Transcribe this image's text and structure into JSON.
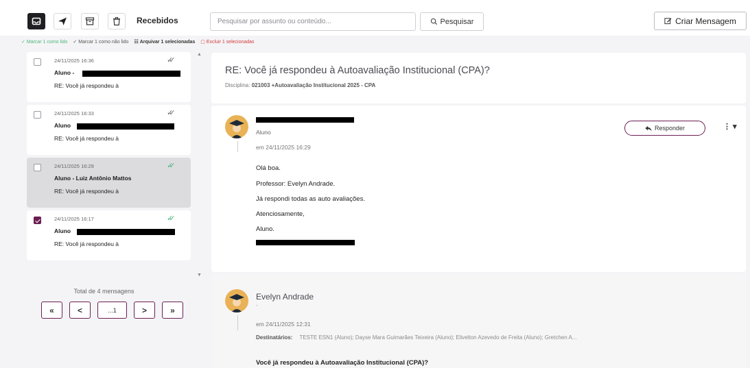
{
  "toolbar": {
    "folder_title": "Recebidos",
    "search_placeholder": "Pesquisar por assunto ou conteúdo...",
    "search_label": "Pesquisar",
    "create_label": "Criar Mensagem"
  },
  "actions": {
    "mark_read": "Marcar 1 como lido",
    "mark_unread": "Marcar 1 como não lido",
    "archive": "Arquivar 1 selecionadas",
    "delete": "Excluir 1 selecionadas"
  },
  "messages": [
    {
      "date": "24/11/2025 16:36",
      "sender": "Aluno -",
      "subject": "RE: Você já respondeu à",
      "checked": false,
      "selected": false,
      "read_color": "#666666"
    },
    {
      "date": "24/11/2025 16:33",
      "sender": "Aluno",
      "subject": "RE: Você já respondeu à",
      "checked": false,
      "selected": false,
      "read_color": "#666666"
    },
    {
      "date": "24/11/2025 16:29",
      "sender": "Aluno - Luiz Antônio Mattos",
      "subject": "RE: Você já respondeu à",
      "checked": false,
      "selected": true,
      "read_color": "#4cb57a"
    },
    {
      "date": "24/11/2025 16:17",
      "sender": "Aluno",
      "subject": "RE: Você já respondeu à",
      "checked": true,
      "selected": false,
      "read_color": "#4cb57a"
    }
  ],
  "list_footer": {
    "total": "Total de 4 mensagens",
    "first": "«",
    "prev": "<",
    "page": "...1",
    "next": ">",
    "last": "»"
  },
  "detail": {
    "title": "RE: Você já respondeu à Autoavaliação Institucional (CPA)?",
    "discipline_label": "Disciplina:",
    "discipline_value": "021003 +Autoavaliação Institucional 2025 - CPA",
    "message1": {
      "role": "Aluno",
      "time": "em 24/11/2025 16:29",
      "reply_label": "Responder",
      "body": [
        "Olá boa.",
        "Professor: Evelyn Andrade.",
        "Já  respondi todas as auto avaliações.",
        "Atenciosamente,",
        "Aluno."
      ]
    },
    "message2": {
      "sender": "Evelyn Andrade",
      "sub": "-",
      "time": "em 24/11/2025 12:31",
      "recipients_label": "Destinatários:",
      "recipients": "TESTE ESN1 (Aluno); Dayse Mara Guimarães Teixeira (Aluno); Elivelton Azevedo de Freita (Aluno); Gretchen A...",
      "question": "Você já respondeu à Autoavaliação Institucional (CPA)?"
    }
  },
  "colors": {
    "accent": "#6a1d52",
    "read_green": "#4cb57a",
    "delete_red": "#d23b3b",
    "avatar": "#e9b256"
  }
}
